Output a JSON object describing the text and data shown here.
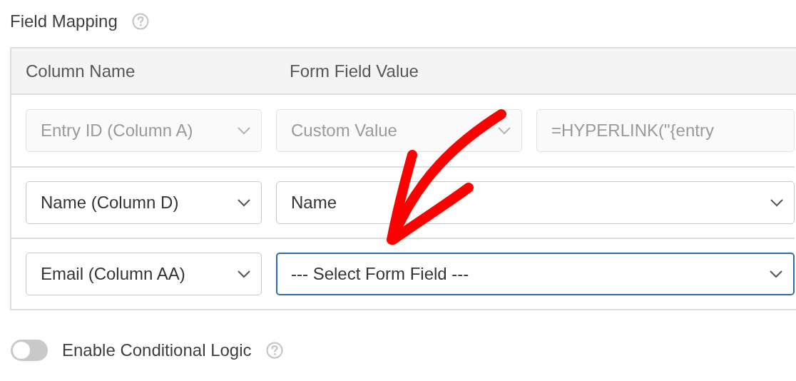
{
  "section": {
    "title": "Field Mapping"
  },
  "table": {
    "columns": [
      "Column Name",
      "Form Field Value"
    ],
    "rows": [
      {
        "kind": "custom",
        "disabled": true,
        "column": "Entry ID (Column A)",
        "field": "Custom Value",
        "focused": false,
        "custom_value": "=HYPERLINK(\"{entry"
      },
      {
        "kind": "field",
        "disabled": false,
        "column": "Name (Column D)",
        "field": "Name",
        "focused": false
      },
      {
        "kind": "field",
        "disabled": false,
        "column": "Email (Column AA)",
        "field": "--- Select Form Field ---",
        "focused": true
      }
    ]
  },
  "conditional_logic": {
    "label": "Enable Conditional Logic",
    "on": false
  }
}
